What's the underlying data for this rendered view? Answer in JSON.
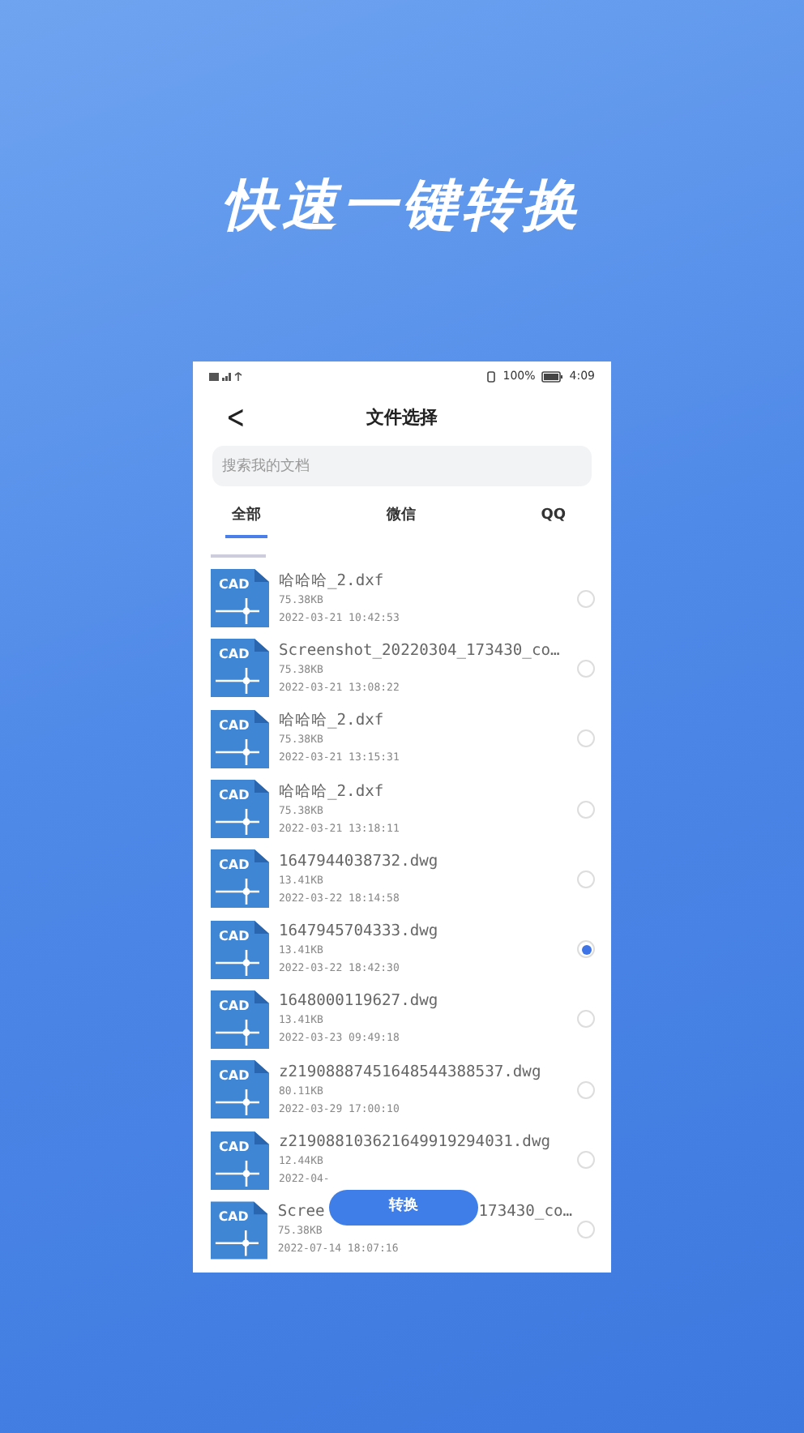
{
  "headline": "快速一键转换",
  "status_bar": {
    "battery": "100%",
    "time": "4:09"
  },
  "header": {
    "back": "<",
    "title": "文件选择"
  },
  "search": {
    "placeholder": "搜索我的文档"
  },
  "tabs": [
    {
      "label": "全部",
      "selected": true
    },
    {
      "label": "微信",
      "selected": false
    },
    {
      "label": "QQ",
      "selected": false
    }
  ],
  "files": [
    {
      "icon_label": "CAD",
      "name": "哈哈哈_2.dxf",
      "size": "75.38KB",
      "date": "2022-03-21 10:42:53",
      "selected": false
    },
    {
      "icon_label": "CAD",
      "name": "Screenshot_20220304_173430_co…",
      "size": "75.38KB",
      "date": "2022-03-21 13:08:22",
      "selected": false
    },
    {
      "icon_label": "CAD",
      "name": "哈哈哈_2.dxf",
      "size": "75.38KB",
      "date": "2022-03-21 13:15:31",
      "selected": false
    },
    {
      "icon_label": "CAD",
      "name": "哈哈哈_2.dxf",
      "size": "75.38KB",
      "date": "2022-03-21 13:18:11",
      "selected": false
    },
    {
      "icon_label": "CAD",
      "name": "1647944038732.dwg",
      "size": "13.41KB",
      "date": "2022-03-22 18:14:58",
      "selected": false
    },
    {
      "icon_label": "CAD",
      "name": "1647945704333.dwg",
      "size": "13.41KB",
      "date": "2022-03-22 18:42:30",
      "selected": true
    },
    {
      "icon_label": "CAD",
      "name": "1648000119627.dwg",
      "size": "13.41KB",
      "date": "2022-03-23 09:49:18",
      "selected": false
    },
    {
      "icon_label": "CAD",
      "name": "z21908887451648544388537.dwg",
      "size": "80.11KB",
      "date": "2022-03-29 17:00:10",
      "selected": false
    },
    {
      "icon_label": "CAD",
      "name": "z219088103621649919294031.dwg",
      "size": "12.44KB",
      "date": "2022-04-",
      "selected": false
    },
    {
      "icon_label": "CAD",
      "name": "Scree",
      "name_tail": "173430_co…",
      "size": "75.38KB",
      "date": "2022-07-14 18:07:16",
      "selected": false
    }
  ],
  "convert_button": "转换"
}
